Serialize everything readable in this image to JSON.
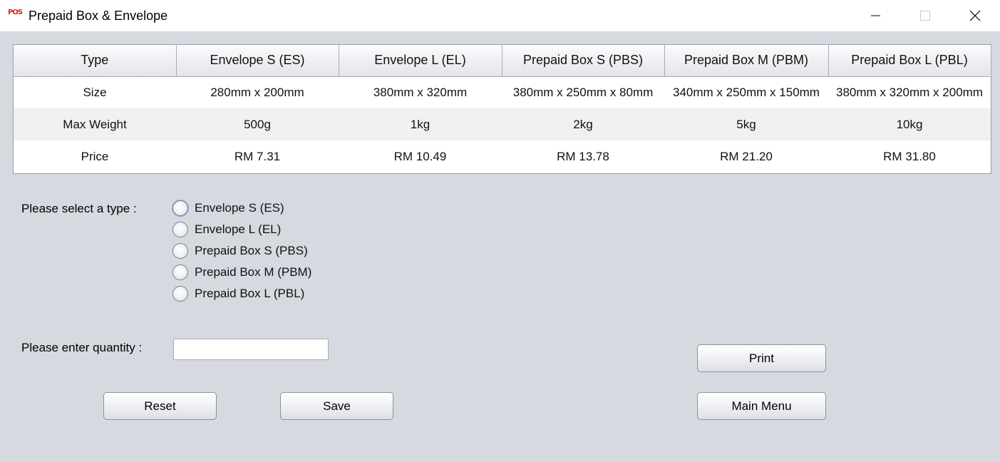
{
  "window": {
    "logo_text": "POS",
    "title": "Prepaid Box & Envelope"
  },
  "table": {
    "headers": [
      "Type",
      "Envelope S (ES)",
      "Envelope L (EL)",
      "Prepaid Box S (PBS)",
      "Prepaid Box M (PBM)",
      "Prepaid Box L (PBL)"
    ],
    "rows": [
      [
        "Size",
        "280mm x 200mm",
        "380mm x 320mm",
        "380mm x 250mm x 80mm",
        "340mm x 250mm x 150mm",
        "380mm x 320mm x 200mm"
      ],
      [
        "Max Weight",
        "500g",
        "1kg",
        "2kg",
        "5kg",
        "10kg"
      ],
      [
        "Price",
        "RM 7.31",
        "RM 10.49",
        "RM 13.78",
        "RM 21.20",
        "RM 31.80"
      ]
    ]
  },
  "form": {
    "type_label": "Please select a type :",
    "type_options": [
      "Envelope S (ES)",
      "Envelope L (EL)",
      "Prepaid Box S (PBS)",
      "Prepaid Box M (PBM)",
      "Prepaid Box L (PBL)"
    ],
    "quantity_label": "Please enter quantity :",
    "quantity_value": ""
  },
  "buttons": {
    "print": "Print",
    "reset": "Reset",
    "save": "Save",
    "main_menu": "Main Menu"
  }
}
